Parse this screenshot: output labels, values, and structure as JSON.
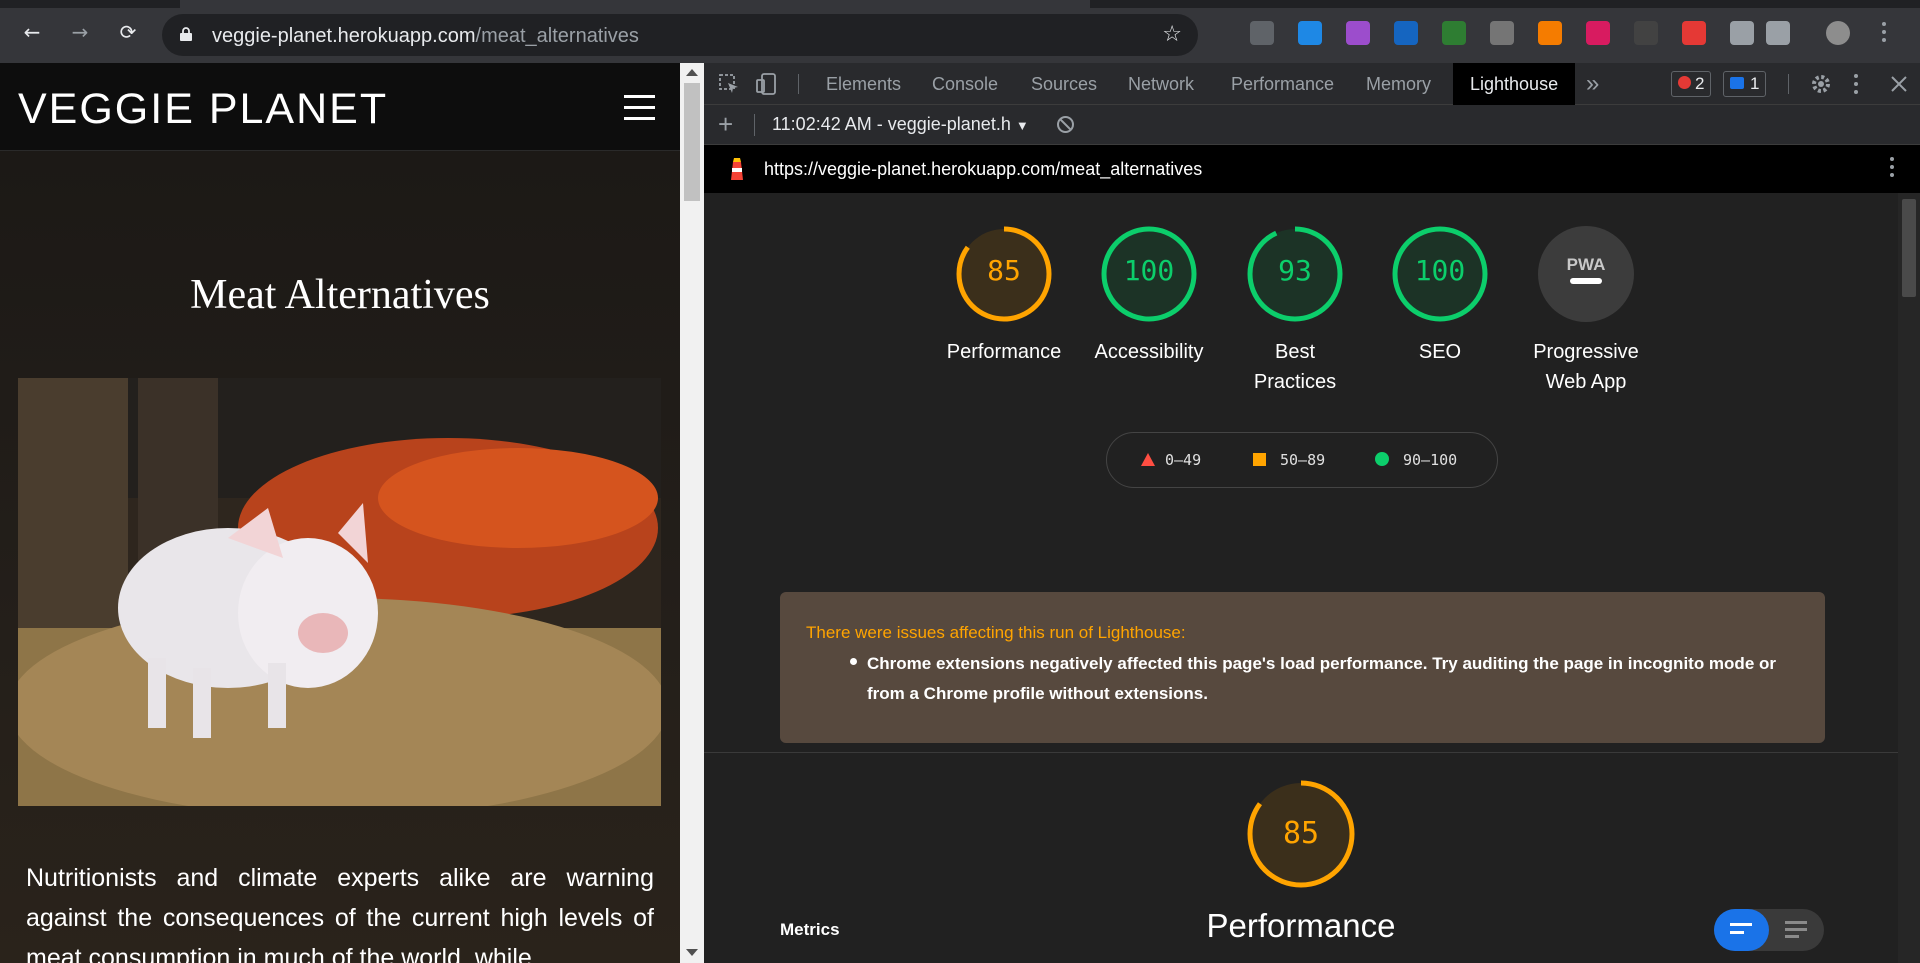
{
  "browser": {
    "url_host": "veggie-planet.herokuapp.com",
    "url_path": "/meat_alternatives"
  },
  "site": {
    "brand": "VEGGIE PLANET",
    "title": "Meat Alternatives",
    "hero_alt": "pig",
    "paragraph": "Nutritionists and climate experts alike are warning against the consequences of the current high levels of meat consumption in much of the world, while"
  },
  "devtools": {
    "tabs": [
      "Elements",
      "Console",
      "Sources",
      "Network",
      "Performance",
      "Memory",
      "Lighthouse"
    ],
    "active_tab": "Lighthouse",
    "more_tabs": "»",
    "errors_count": "2",
    "messages_count": "1",
    "report_label": "11:02:42 AM - veggie-planet.h",
    "plus": "+"
  },
  "lighthouse": {
    "report_url": "https://veggie-planet.herokuapp.com/meat_alternatives",
    "scores": [
      {
        "label": "Performance",
        "value": "85",
        "fraction": 0.85,
        "color": "#ffa400"
      },
      {
        "label": "Accessibility",
        "value": "100",
        "fraction": 1.0,
        "color": "#0cce6b"
      },
      {
        "label": "Best Practices",
        "value": "93",
        "fraction": 0.93,
        "color": "#0cce6b"
      },
      {
        "label": "SEO",
        "value": "100",
        "fraction": 1.0,
        "color": "#0cce6b"
      },
      {
        "label": "Progressive Web App",
        "value": "PWA",
        "fraction": 0,
        "color": "#9aa0a6"
      }
    ],
    "legend": [
      {
        "range": "0–49",
        "color": "#ff4e42",
        "shape": "triangle"
      },
      {
        "range": "50–89",
        "color": "#ffa400",
        "shape": "square"
      },
      {
        "range": "90–100",
        "color": "#0cce6b",
        "shape": "circle"
      }
    ],
    "warning_title": "There were issues affecting this run of Lighthouse:",
    "warning_message": "Chrome extensions negatively affected this page's load performance. Try auditing the page in incognito mode or from a Chrome profile without extensions.",
    "section_score": "85",
    "section_fraction": 0.85,
    "section_title": "Performance",
    "metrics_label": "Metrics"
  }
}
